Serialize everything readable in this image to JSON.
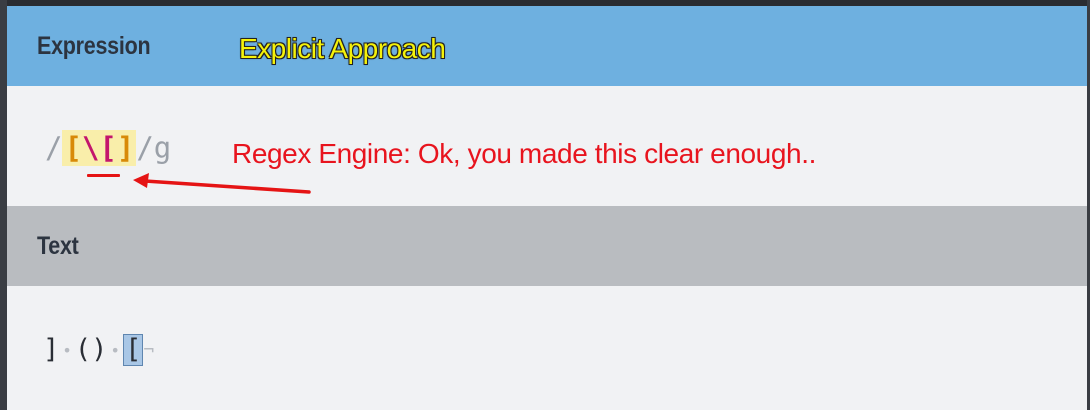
{
  "expression_section": {
    "title": "Expression",
    "annotation": "Explicit Approach",
    "regex": {
      "open_delimiter": "/",
      "class_open": "[",
      "escaped_char": "\\[",
      "class_close": "]",
      "close_delimiter": "/",
      "flags": "g"
    },
    "note": "Regex Engine: Ok, you made this clear enough.."
  },
  "text_section": {
    "title": "Text",
    "sample": [
      {
        "type": "char",
        "value": "]"
      },
      {
        "type": "space",
        "value": "•"
      },
      {
        "type": "char",
        "value": "()"
      },
      {
        "type": "space",
        "value": "•"
      },
      {
        "type": "match",
        "value": "["
      },
      {
        "type": "eol",
        "value": "¬"
      }
    ]
  },
  "colors": {
    "header_blue": "#6eb0e0",
    "text_header_gray": "#b9bcc0",
    "annotation_yellow": "#f5f20a",
    "annotation_red": "#e8141e",
    "class_highlight": "#f9eeaa",
    "match_highlight": "#a9c7e6"
  }
}
